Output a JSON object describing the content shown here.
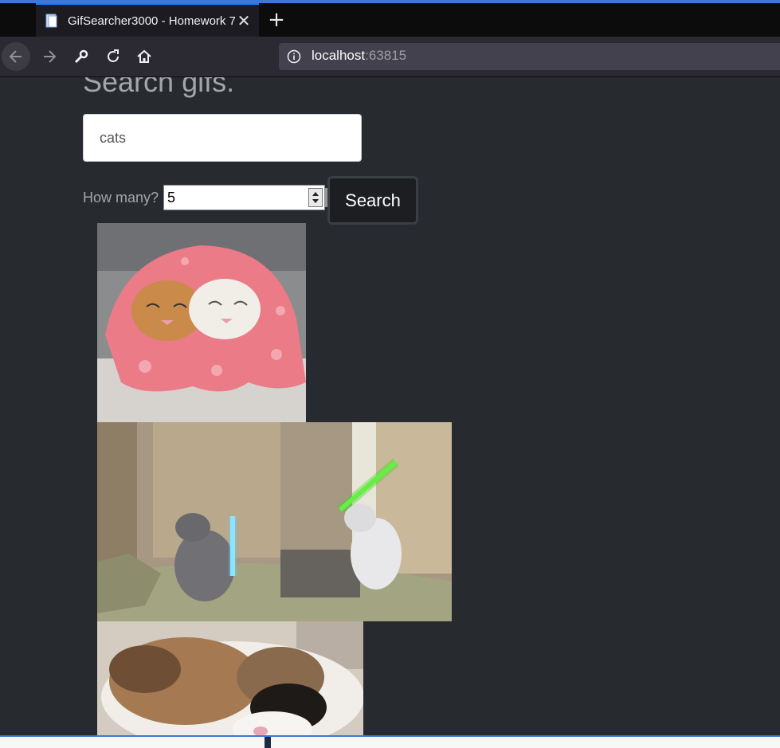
{
  "browser": {
    "tab_title": "GifSearcher3000 - Homework 7",
    "new_tab_label": "+",
    "close_label": "✕",
    "url_host": "localhost",
    "url_port": ":63815"
  },
  "page": {
    "heading": "Search gifs.",
    "search_value": "cats",
    "howmany_label": "How many?",
    "count_value": "5",
    "search_button": "Search"
  },
  "results": [
    {
      "name": "gif-cats-in-pink-blanket"
    },
    {
      "name": "gif-cats-lightsaber-duel"
    },
    {
      "name": "gif-sleeping-calico-cat"
    }
  ],
  "colors": {
    "page_bg": "#272b30",
    "muted_text": "#a3a6aa",
    "tab_accent": "#0a84ff"
  }
}
